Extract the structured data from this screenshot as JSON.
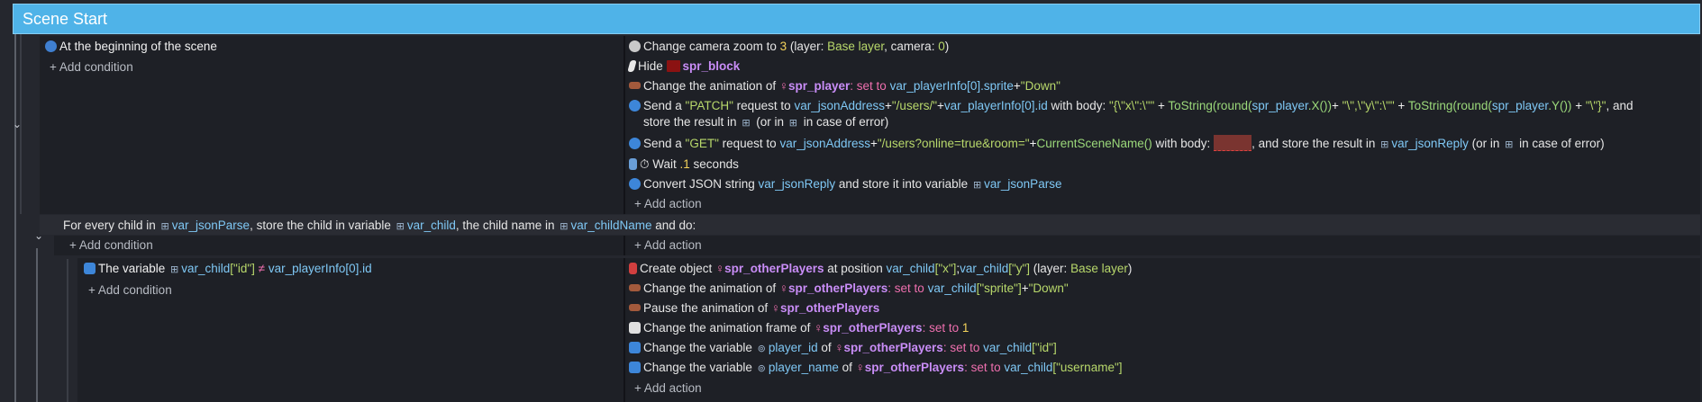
{
  "header": {
    "title": "Scene Start"
  },
  "event1": {
    "condition": "At the beginning of the scene",
    "add_condition": "+ Add condition",
    "actions": {
      "a1": {
        "t1": "Change camera zoom to ",
        "num": "3",
        "t2": " (layer: ",
        "layer": "Base layer",
        "t3": ", camera: ",
        "cam": "0",
        "t4": ")"
      },
      "a2": {
        "t1": "Hide ",
        "obj": "spr_block"
      },
      "a3": {
        "t1": "Change the animation of ",
        "obj": "spr_player",
        "t2": ": set to ",
        "v1": "var_playerInfo[0].sprite",
        "t3": "+",
        "s1": "\"Down\""
      },
      "a4": {
        "t1": "Send a ",
        "s1": "\"PATCH\"",
        "t2": " request to ",
        "v1": "var_jsonAddress",
        "t3": "+",
        "s2": "\"/users/\"",
        "t4": "+",
        "v2": "var_playerInfo[0].id",
        "t5": " with body: ",
        "s3": "\"{\\\"x\\\":\\\"\"",
        "t6": " + ",
        "f1": "ToString(",
        "f2": "round(",
        "o1": "spr_player",
        "f3": ".X())",
        "t7": "+ ",
        "s4": "\"\\\",\\\"y\\\":\\\"\"",
        "t8": " + ",
        "f4": "ToString(",
        "f5": "round(",
        "o2": "spr_player",
        "f6": ".Y())",
        "t9": " + ",
        "s5": "\"\\\"}\"",
        "t10": ", and",
        "line2a": "store the result in ",
        "line2b": " (or in ",
        "line2c": " in case of error)"
      },
      "a5": {
        "t1": "Send a ",
        "s1": "\"GET\"",
        "t2": " request to ",
        "v1": "var_jsonAddress",
        "t3": "+",
        "s2": "\"/users?online=true&room=\"",
        "t4": "+",
        "f1": "CurrentSceneName()",
        "t5": " with body: ",
        "t6": ", and store the result in ",
        "v2": "var_jsonReply",
        "t7": " (or in ",
        "t8": " in case of error)"
      },
      "a6": {
        "t1": "Wait ",
        "num": ".1",
        "t2": " seconds"
      },
      "a7": {
        "t1": "Convert JSON string ",
        "v1": "var_jsonReply",
        "t2": " and store it into variable ",
        "v2": "var_jsonParse"
      },
      "add_action": "+ Add action"
    }
  },
  "foreach": {
    "t1": "For every child in ",
    "v1": "var_jsonParse",
    "t2": ", store the child in variable ",
    "v2": "var_child",
    "t3": ", the child name in ",
    "v3": "var_childName",
    "t4": " and do:",
    "add_condition": "+ Add condition",
    "add_action": "+ Add action"
  },
  "event2": {
    "cond": {
      "t1": "The variable ",
      "v1": "var_child",
      "s1": "[\"id\"]",
      "op": " ≠ ",
      "v2": "var_playerInfo[0].id"
    },
    "add_condition": "+ Add condition",
    "actions": {
      "b1": {
        "t1": "Create object ",
        "obj": "spr_otherPlayers",
        "t2": " at position ",
        "v1": "var_child",
        "s1": "[\"x\"]",
        "t3": ";",
        "v2": "var_child",
        "s2": "[\"y\"]",
        "t4": " (layer: ",
        "layer": "Base layer",
        "t5": ")"
      },
      "b2": {
        "t1": "Change the animation of ",
        "obj": "spr_otherPlayers",
        "t2": ": set to ",
        "v1": "var_child",
        "s1": "[\"sprite\"]",
        "t3": "+",
        "s2": "\"Down\""
      },
      "b3": {
        "t1": "Pause the animation of ",
        "obj": "spr_otherPlayers"
      },
      "b4": {
        "t1": "Change the animation frame of ",
        "obj": "spr_otherPlayers",
        "t2": ": set to ",
        "num": "1"
      },
      "b5": {
        "t1": "Change the variable ",
        "v1": "player_id",
        "t2": " of ",
        "obj": "spr_otherPlayers",
        "t3": ": set to ",
        "v2": "var_child",
        "s1": "[\"id\"]"
      },
      "b6": {
        "t1": "Change the variable ",
        "v1": "player_name",
        "t2": " of ",
        "obj": "spr_otherPlayers",
        "t3": ": set to ",
        "v2": "var_child",
        "s1": "[\"username\"]"
      },
      "add_action": "+ Add action"
    }
  },
  "colors": {
    "header": "#4fb3e8",
    "panel": "#1e2026",
    "background": "#25272e"
  }
}
